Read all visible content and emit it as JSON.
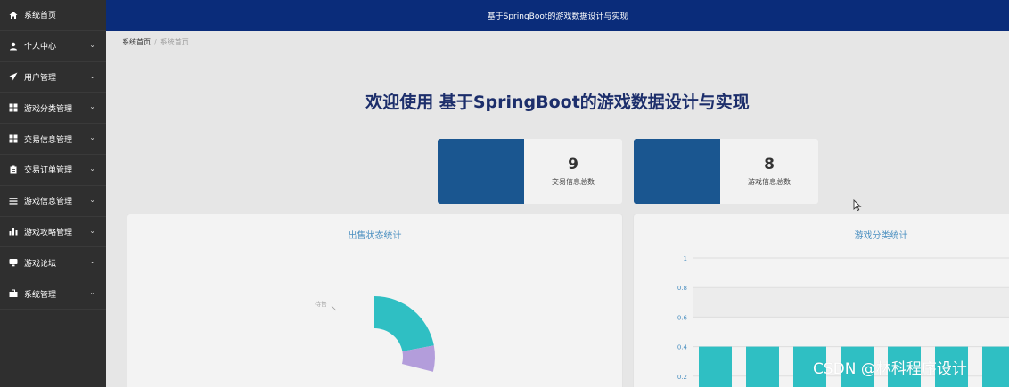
{
  "sidebar": {
    "items": [
      {
        "label": "系统首页",
        "icon": "home-icon",
        "has_chevron": false
      },
      {
        "label": "个人中心",
        "icon": "user-icon",
        "has_chevron": true
      },
      {
        "label": "用户管理",
        "icon": "paper-plane-icon",
        "has_chevron": true
      },
      {
        "label": "游戏分类管理",
        "icon": "grid-icon",
        "has_chevron": true
      },
      {
        "label": "交易信息管理",
        "icon": "grid-icon",
        "has_chevron": true
      },
      {
        "label": "交易订单管理",
        "icon": "clipboard-icon",
        "has_chevron": true
      },
      {
        "label": "游戏信息管理",
        "icon": "list-icon",
        "has_chevron": true
      },
      {
        "label": "游戏攻略管理",
        "icon": "bar-chart-icon",
        "has_chevron": true
      },
      {
        "label": "游戏论坛",
        "icon": "monitor-icon",
        "has_chevron": true
      },
      {
        "label": "系统管理",
        "icon": "briefcase-icon",
        "has_chevron": true
      }
    ]
  },
  "header": {
    "title": "基于SpringBoot的游戏数据设计与实现"
  },
  "breadcrumb": {
    "home": "系统首页",
    "current": "系统首页"
  },
  "welcome": {
    "text": "欢迎使用 基于SpringBoot的游戏数据设计与实现"
  },
  "stats": [
    {
      "value": "9",
      "caption": "交易信息总数"
    },
    {
      "value": "8",
      "caption": "游戏信息总数"
    }
  ],
  "colors": {
    "sidebar_bg": "#2f2f2f",
    "topbar_bg": "#0a2c7a",
    "stat_block": "#1a5690",
    "teal": "#2fbfc3",
    "lavender": "#b39ddb"
  },
  "chart_data": [
    {
      "type": "pie",
      "title": "出售状态统计",
      "labels": [
        "待售"
      ],
      "slices": [
        {
          "name": "",
          "value": 0.22,
          "color": "#2fbfc3"
        },
        {
          "name": "",
          "value": 0.07,
          "color": "#b39ddb"
        }
      ]
    },
    {
      "type": "bar",
      "title": "游戏分类统计",
      "categories": [
        "",
        "",
        "",
        "",
        "",
        "",
        ""
      ],
      "values": [
        0.4,
        0.4,
        0.4,
        0.4,
        0.4,
        0.4,
        0.4
      ],
      "ylim": [
        0,
        1
      ],
      "yticks": [
        "1",
        "0.8",
        "0.6",
        "0.4",
        "0.2"
      ],
      "grid": true
    }
  ],
  "watermark": "CSDN @林科程序设计"
}
